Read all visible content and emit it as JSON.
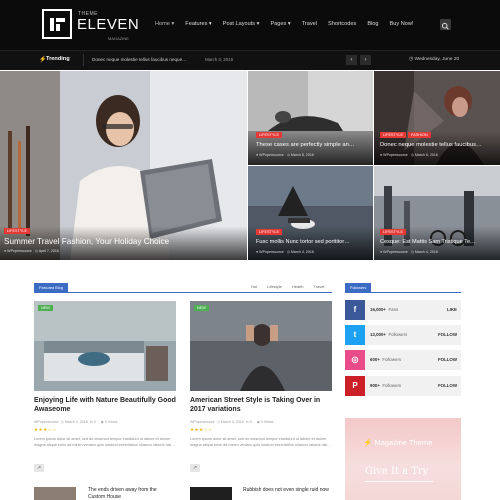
{
  "header": {
    "logo": {
      "theme_word": "THEME",
      "name": "ELEVEN",
      "sub": "MAGAZINE"
    },
    "nav": [
      {
        "label": "Home ▾",
        "active": true
      },
      {
        "label": "Features ▾"
      },
      {
        "label": "Post Layouts ▾"
      },
      {
        "label": "Pages ▾"
      },
      {
        "label": "Travel"
      },
      {
        "label": "Shortcodes"
      },
      {
        "label": "Blog"
      },
      {
        "label": "Buy Now!"
      }
    ],
    "search_icon": "search-icon"
  },
  "trending": {
    "label": "Trending",
    "title": "Donec neque molestie tellus faucibus neque…",
    "date": "March 3, 2016",
    "today": "Wednesday, June 20"
  },
  "hero": {
    "main": {
      "badge": "Lifestyle",
      "title": "Summer Travel Fashion, Your Holiday Choice",
      "author": "WPopensource",
      "date": "April 7, 2016"
    },
    "tiles": [
      {
        "badge": "Lifestyle",
        "title": "These cases are perfectly simple an…",
        "author": "WPopensource",
        "date": "March 8, 2016"
      },
      {
        "badge": "Lifestyle",
        "badge2": "Fashion",
        "title": "Donec neque molestie tellus faucibus…",
        "author": "WPopensource",
        "date": "March 8, 2016"
      },
      {
        "badge": "Lifestyle",
        "title": "Fusc mollis Nunc tortor sed porttitor…",
        "author": "WPopensource",
        "date": "March 4, 2016"
      },
      {
        "badge": "Lifestyle",
        "title": "Cesque: Est Mattis Sam Tristique Te…",
        "author": "WPopensource",
        "date": "March 4, 2016"
      }
    ]
  },
  "section": {
    "title": "Featured Blog",
    "filters": [
      "Hot",
      "Lifestyle",
      "Health",
      "Travel"
    ]
  },
  "cards": [
    {
      "badge": "NEW",
      "title": "Enjoying Life with Nature Beautifully Good Awaseome",
      "author": "WPopensource",
      "date": "March 4, 2016",
      "comments": "0",
      "views": "0 Views",
      "stars": "★★★☆☆",
      "text": "Lorem ipsum dolor sit amet, sed do eiusmod tempor incididunt ut labore et dolore magna aliqua enim ad minim veniam quis nostrud exercitation ullamco laboris nisi…"
    },
    {
      "badge": "NEW",
      "title": "American Street Style is Taking Over in 2017 variations",
      "author": "WPopensource",
      "date": "March 4, 2016",
      "comments": "0",
      "views": "0 Views",
      "stars": "★★★☆☆",
      "text": "Lorem ipsum dolor sit amet, sed do eiusmod tempor incididunt ut labore et dolore magna aliqua enim ad minim veniam quis nostrud exercitation ullamco laboris nisi…"
    }
  ],
  "mini_posts": [
    {
      "title": "The ends driven away from the Custom House"
    },
    {
      "title": "Rubbish does not even single ruid now"
    }
  ],
  "sidebar": {
    "title": "Followers",
    "social": [
      {
        "icon": "facebook-icon",
        "glyph": "f",
        "color": "#3b5998",
        "count": "16,000+",
        "label": "Fans",
        "action": "LIKE"
      },
      {
        "icon": "twitter-icon",
        "glyph": "t",
        "color": "#1da1f2",
        "count": "12,000+",
        "label": "Followers",
        "action": "FOLLOW"
      },
      {
        "icon": "dribbble-icon",
        "glyph": "◎",
        "color": "#ea4c89",
        "count": "600+",
        "label": "Followers",
        "action": "FOLLOW"
      },
      {
        "icon": "pinterest-icon",
        "glyph": "P",
        "color": "#cb2027",
        "count": "900+",
        "label": "Followers",
        "action": "FOLLOW"
      }
    ],
    "ad": {
      "title": "Magazine Theme",
      "cta": "Give It a Try"
    }
  },
  "colors": {
    "accent": "#3b6bc2",
    "badge": "#e53935",
    "header": "#0b0b0b"
  }
}
